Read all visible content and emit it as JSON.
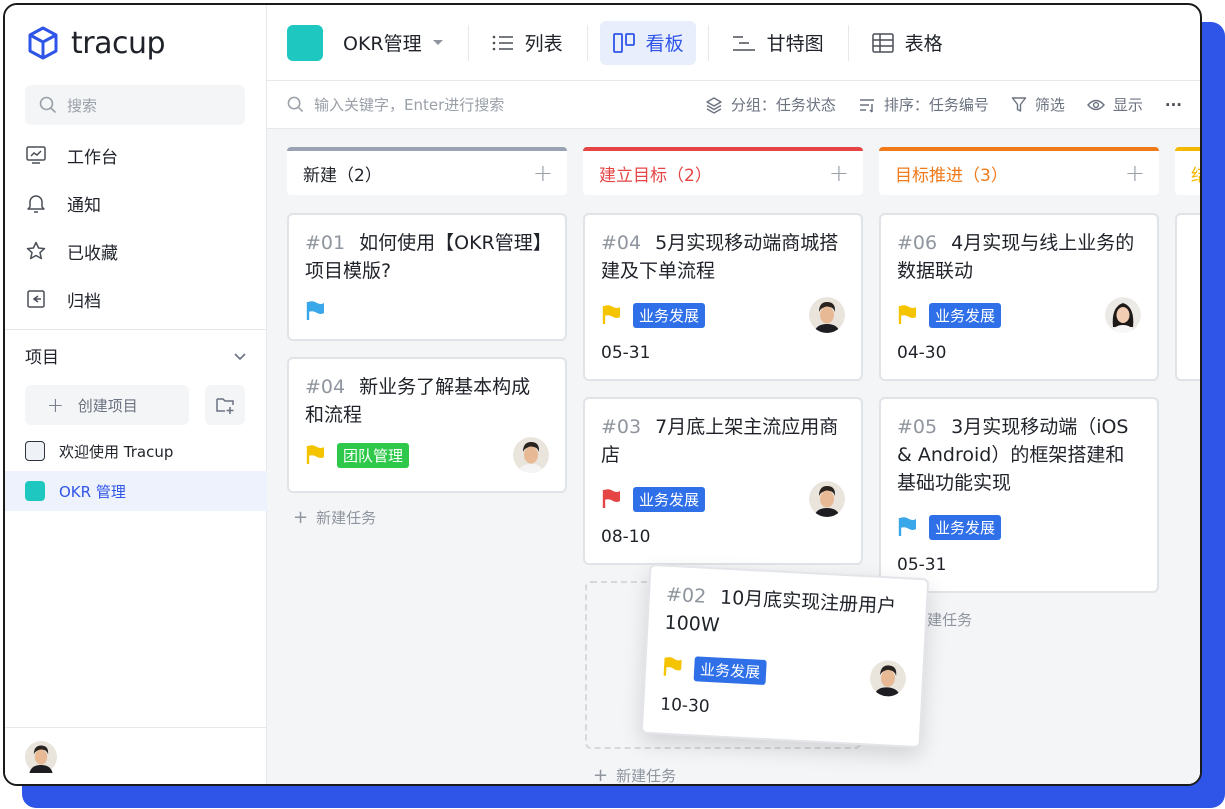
{
  "app": {
    "logo_text": "tracup",
    "brand_color": "#2f55e8"
  },
  "sidebar": {
    "search_placeholder": "搜索",
    "nav": [
      {
        "label": "工作台",
        "icon": "monitor-icon"
      },
      {
        "label": "通知",
        "icon": "bell-icon"
      },
      {
        "label": "已收藏",
        "icon": "star-icon"
      },
      {
        "label": "归档",
        "icon": "archive-icon"
      }
    ],
    "projects_label": "项目",
    "create_project_label": "创建项目",
    "projects": [
      {
        "label": "欢迎使用 Tracup",
        "color": "#e8ecf4"
      },
      {
        "label": "OKR 管理",
        "color": "#1ec8c0",
        "active": true
      }
    ]
  },
  "topbar": {
    "project_name": "OKR管理",
    "views": [
      {
        "label": "列表",
        "icon": "list-icon"
      },
      {
        "label": "看板",
        "icon": "board-icon",
        "active": true
      },
      {
        "label": "甘特图",
        "icon": "gantt-icon"
      },
      {
        "label": "表格",
        "icon": "table-icon"
      }
    ]
  },
  "toolbar": {
    "search_placeholder": "输入关键字，Enter进行搜索",
    "group_label": "分组：任务状态",
    "sort_label": "排序：任务编号",
    "filter_label": "筛选",
    "display_label": "显示",
    "more_label": "···"
  },
  "board": {
    "new_task_label": "新建任务",
    "columns": [
      {
        "title": "新建（2）",
        "color": "#9aa3b4",
        "title_color": "#1f2329"
      },
      {
        "title": "建立目标（2）",
        "color": "#e54545",
        "title_color": "#e54545"
      },
      {
        "title": "目标推进（3）",
        "color": "#f07a1a",
        "title_color": "#f07a1a"
      },
      {
        "title": "结",
        "color": "#f5b800",
        "title_color": "#f5b800"
      }
    ],
    "cards": [
      {
        "num": "#01",
        "title": "如何使用【OKR管理】项目模版?",
        "flag": "#3aa8e8",
        "tag": "",
        "date": ""
      },
      {
        "num": "#04",
        "title": "新业务了解基本构成和流程",
        "flag": "#f5c400",
        "tag": "团队管理",
        "date": ""
      },
      {
        "num": "#04",
        "title": "5月实现移动端商城搭建及下单流程",
        "flag": "#f5c400",
        "tag": "业务发展",
        "date": "05-31"
      },
      {
        "num": "#03",
        "title": "7月底上架主流应用商店",
        "flag": "#e54545",
        "tag": "业务发展",
        "date": "08-10"
      },
      {
        "num": "#06",
        "title": "4月实现与线上业务的数据联动",
        "flag": "#f5c400",
        "tag": "业务发展",
        "date": "04-30"
      },
      {
        "num": "#05",
        "title": "3月实现移动端（iOS & Android）的框架搭建和基础功能实现",
        "flag": "#3aa8e8",
        "tag": "业务发展",
        "date": "05-31"
      },
      {
        "num": "#02",
        "title": "10月底实现注册用户100W",
        "flag": "#f5c400",
        "tag": "业务发展",
        "date": "10-30"
      }
    ]
  }
}
